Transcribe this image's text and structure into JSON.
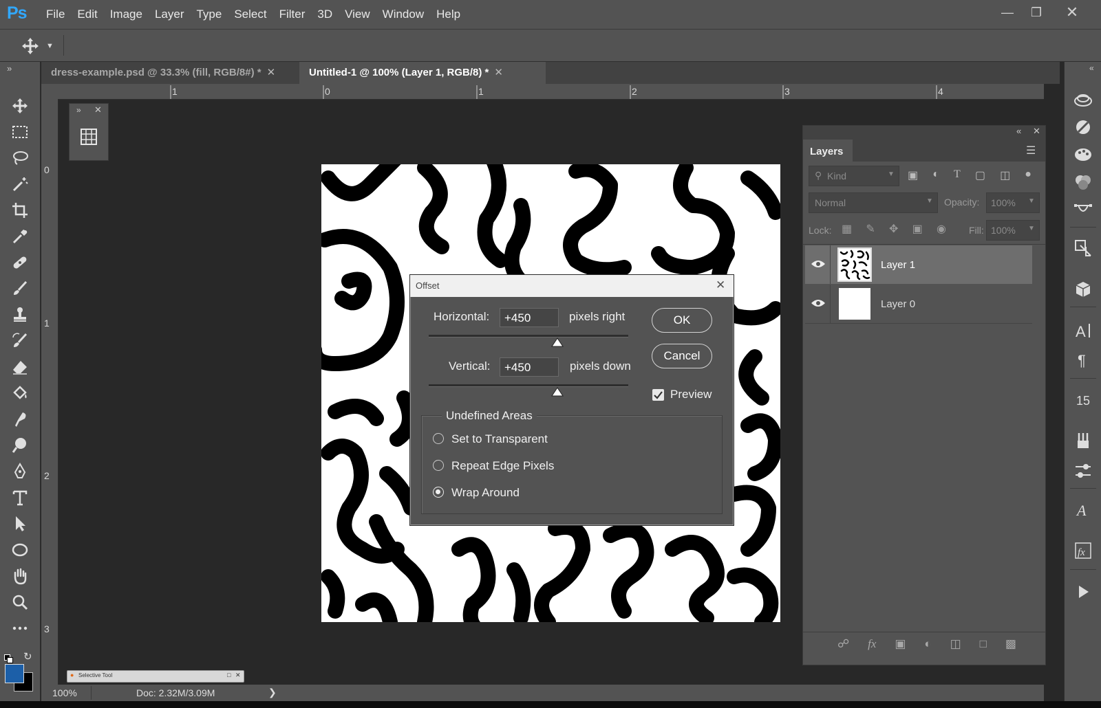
{
  "app": {
    "logo": "Ps"
  },
  "menus": [
    "File",
    "Edit",
    "Image",
    "Layer",
    "Type",
    "Select",
    "Filter",
    "3D",
    "View",
    "Window",
    "Help"
  ],
  "tabs": [
    {
      "label": "dress-example.psd @ 33.3% (fill, RGB/8#) *",
      "active": false
    },
    {
      "label": "Untitled-1 @ 100% (Layer 1, RGB/8) *",
      "active": true
    }
  ],
  "ruler": {
    "top": [
      "1",
      "0",
      "1",
      "2",
      "3",
      "4"
    ],
    "left": [
      "0",
      "1",
      "2",
      "3"
    ]
  },
  "status": {
    "zoom": "100%",
    "doc": "Doc: 2.32M/3.09M",
    "arrow": "❯"
  },
  "mini_window": {
    "title": "Selective Tool"
  },
  "layers_panel": {
    "title": "Layers",
    "kind_label": "Kind",
    "blend_mode": "Normal",
    "opacity_label": "Opacity:",
    "opacity_value": "100%",
    "lock_label": "Lock:",
    "fill_label": "Fill:",
    "fill_value": "100%",
    "layers": [
      {
        "name": "Layer 1",
        "selected": true
      },
      {
        "name": "Layer 0",
        "selected": false
      }
    ]
  },
  "dialog": {
    "title": "Offset",
    "horizontal_label": "Horizontal:",
    "horizontal_value": "+450",
    "horizontal_unit": "pixels right",
    "vertical_label": "Vertical:",
    "vertical_value": "+450",
    "vertical_unit": "pixels down",
    "ok_label": "OK",
    "cancel_label": "Cancel",
    "preview_label": "Preview",
    "preview_checked": true,
    "group_title": "Undefined Areas",
    "options": [
      "Set to Transparent",
      "Repeat Edge Pixels",
      "Wrap Around"
    ],
    "selected_option": "Wrap Around"
  },
  "colors": {
    "foreground": "#1c5fa8",
    "background": "#000000",
    "accent": "#31a8ff"
  }
}
